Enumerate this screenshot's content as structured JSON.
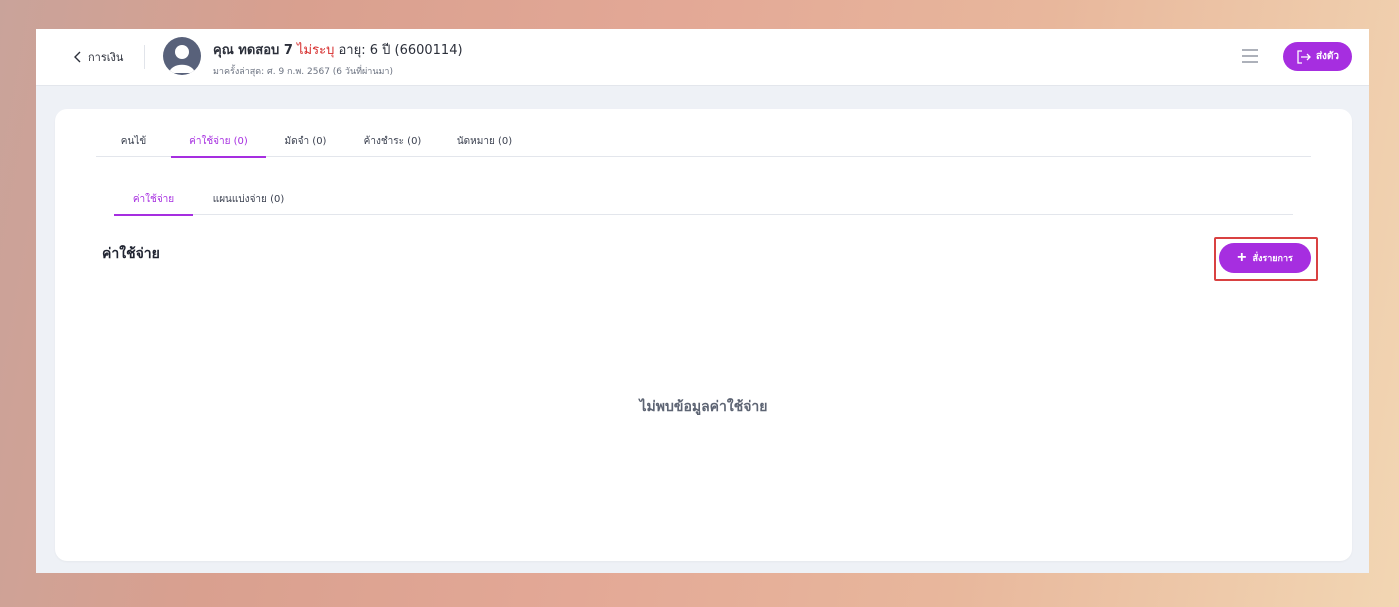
{
  "header": {
    "back_label": "การเงิน",
    "patient_name": "คุณ ทดสอบ 7",
    "patient_sex": "ไม่ระบุ",
    "patient_age": "อายุ: 6 ปี (6600114)",
    "last_visit": "มาครั้งล่าสุด: ศ. 9 ก.พ. 2567 (6 วันที่ผ่านมา)",
    "send_label": "ส่งตัว"
  },
  "tabs": [
    {
      "label": "คนไข้"
    },
    {
      "label": "ค่าใช้จ่าย (0)"
    },
    {
      "label": "มัดจำ (0)"
    },
    {
      "label": "ค้างชำระ (0)"
    },
    {
      "label": "นัดหมาย (0)"
    }
  ],
  "subtabs": [
    {
      "label": "ค่าใช้จ่าย"
    },
    {
      "label": "แผนแบ่งจ่าย (0)"
    }
  ],
  "section": {
    "title": "ค่าใช้จ่าย",
    "add_label": "สั่งรายการ",
    "empty_message": "ไม่พบข้อมูลค่าใช้จ่าย"
  },
  "colors": {
    "accent": "#a62ee0",
    "alert_red": "#d62b2b",
    "highlight": "#d94141"
  },
  "icons": {
    "back": "chevron-left-icon",
    "avatar": "user-avatar-icon",
    "menu": "hamburger-menu-icon",
    "send": "logout-arrow-icon",
    "add": "plus-icon"
  }
}
